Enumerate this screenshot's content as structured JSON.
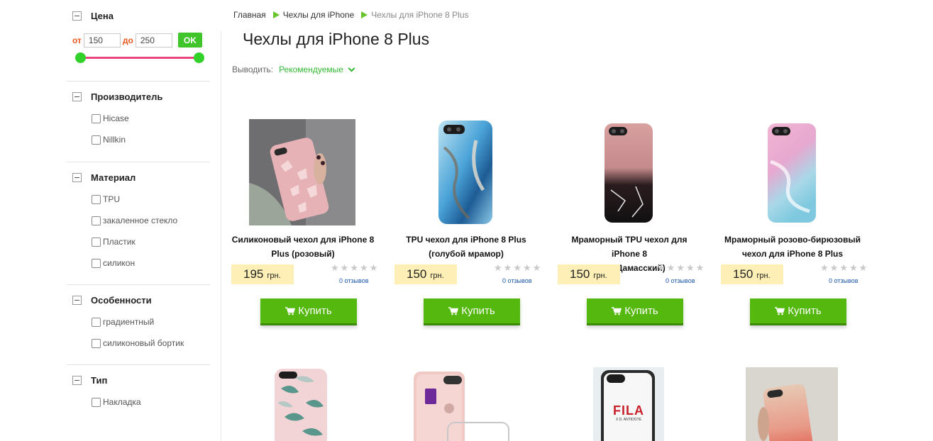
{
  "sidebar": {
    "price": {
      "title": "Цена",
      "from_label": "от",
      "from_value": "150",
      "to_label": "до",
      "to_value": "250",
      "ok_label": "OK"
    },
    "maker": {
      "title": "Производитель",
      "options": [
        "Hicase",
        "Nillkin"
      ]
    },
    "material": {
      "title": "Материал",
      "options": [
        "TPU",
        "закаленное стекло",
        "Пластик",
        "силикон"
      ]
    },
    "features": {
      "title": "Особенности",
      "options": [
        "градиентный",
        "силиконовый бортик"
      ]
    },
    "type": {
      "title": "Тип",
      "options": [
        "Накладка"
      ]
    }
  },
  "breadcrumb": [
    "Главная",
    "Чехлы для iPhone",
    "Чехлы для iPhone 8 Plus"
  ],
  "page_title": "Чехлы для iPhone 8 Plus",
  "sort": {
    "label": "Выводить:",
    "value": "Рекомендуемые"
  },
  "products": [
    {
      "name_line1": "Силиконовый чехол для iPhone 8",
      "name_line2": "Plus (розовый)",
      "price": "195",
      "currency": "грн.",
      "reviews": "0 отзывов",
      "buy_label": "Купить",
      "image": "pink-pearl-case-in-hand"
    },
    {
      "name_line1": "TPU чехол для iPhone 8 Plus",
      "name_line2": "(голубой мрамор)",
      "price": "150",
      "currency": "грн.",
      "reviews": "0 отзывов",
      "buy_label": "Купить",
      "image": "blue-marble-case"
    },
    {
      "name_line1": "Мраморный TPU чехол для iPhone 8",
      "name_line2": "Plus (Дамасский)",
      "price": "150",
      "currency": "грн.",
      "reviews": "0 отзывов",
      "buy_label": "Купить",
      "image": "pink-black-marble-case"
    },
    {
      "name_line1": "Мраморный розово-бирюзовый",
      "name_line2": "чехол для iPhone 8 Plus",
      "price": "150",
      "currency": "грн.",
      "reviews": "0 отзывов",
      "buy_label": "Купить",
      "image": "pink-turquoise-marble-case"
    }
  ],
  "products_row2": [
    {
      "image": "leaf-pattern-case"
    },
    {
      "image": "clear-case-rose-gold-phone"
    },
    {
      "image": "white-case",
      "logo_text": "FILA",
      "logo_sub": "X D. ANTIDOTE"
    },
    {
      "image": "gradient-case-in-hand"
    }
  ],
  "colors": {
    "accent_green": "#54b80e",
    "price_bg": "#fdefb6",
    "slider_track": "#e8457c",
    "link_blue": "#1a56a8"
  }
}
